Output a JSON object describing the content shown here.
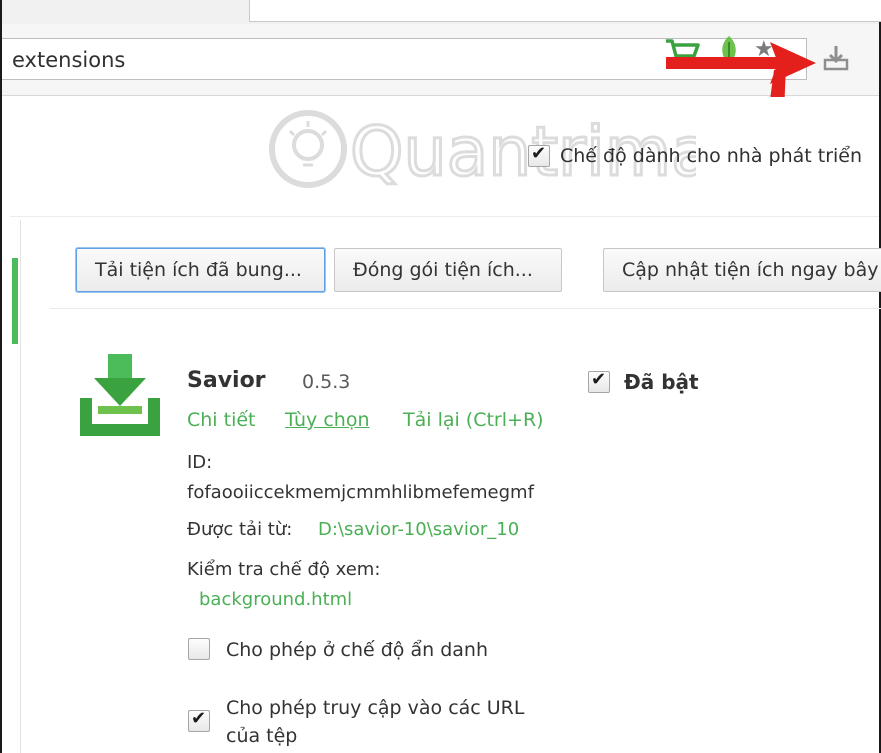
{
  "toolbar": {
    "omnibox_text": "extensions",
    "star_glyph": "★"
  },
  "header": {
    "watermark_text": "Quantrimang",
    "developer_mode_label": "Chế độ dành cho nhà phát triển",
    "developer_mode_checked": true
  },
  "actions": {
    "load_unpacked": "Tải tiện ích đã bung...",
    "pack_extension": "Đóng gói tiện ích...",
    "update_now": "Cập nhật tiện ích ngay bây"
  },
  "extension": {
    "name": "Savior",
    "version": "0.5.3",
    "enabled_label": "Đã bật",
    "enabled": true,
    "links": {
      "details": "Chi tiết",
      "options": "Tùy chọn",
      "reload": "Tải lại (Ctrl+R)"
    },
    "id_label": "ID:",
    "id_value": "fofaooiiccekmemjcmmhlibmefemegmf",
    "loaded_from_label": "Được tải từ:",
    "loaded_from_path": "D:\\savior-10\\savior_10",
    "inspect_views_label": "Kiểm tra chế độ xem:",
    "inspect_view_link": "background.html",
    "allow_incognito_label": "Cho phép ở chế độ ẩn danh",
    "allow_incognito_checked": false,
    "allow_file_urls_line1": "Cho phép truy cập vào các URL",
    "allow_file_urls_line2": "của tệp",
    "allow_file_urls_checked": true
  },
  "colors": {
    "link_green": "#4bb055",
    "arrow_red": "#e3201b",
    "icon_green": "#3aa33f",
    "focus_blue": "#5f9fe6"
  }
}
